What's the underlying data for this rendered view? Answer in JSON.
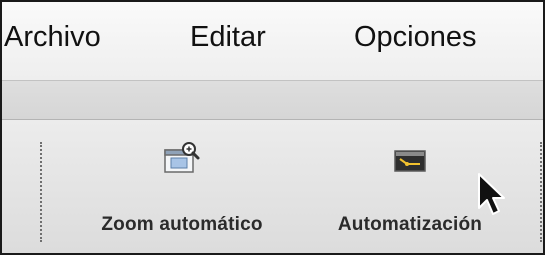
{
  "menubar": {
    "items": [
      {
        "label": "Archivo"
      },
      {
        "label": "Editar"
      },
      {
        "label": "Opciones"
      }
    ]
  },
  "toolbar": {
    "buttons": [
      {
        "label": "Zoom automático",
        "icon": "zoom-window-icon"
      },
      {
        "label": "Automatización",
        "icon": "automation-icon"
      }
    ]
  },
  "cursor": {
    "icon": "arrow-cursor-icon"
  }
}
